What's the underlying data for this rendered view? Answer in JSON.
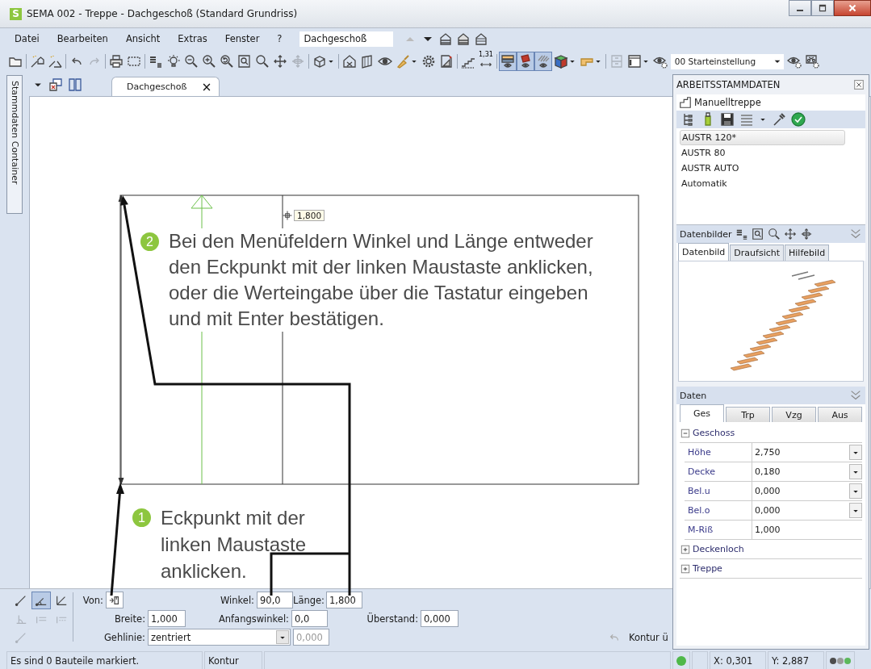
{
  "window": {
    "logo": "S",
    "title": "SEMA  002 - Treppe  - Dachgeschoß (Standard Grundriss)"
  },
  "menu": [
    "Datei",
    "Bearbeiten",
    "Ansicht",
    "Extras",
    "Fenster",
    "?"
  ],
  "level_selector": {
    "value": "Dachgeschoß"
  },
  "toolbar_groups": [
    [
      {
        "kind": "folder",
        "pressed": false,
        "disabled": false,
        "menu": false
      }
    ],
    [
      {
        "kind": "wand-house",
        "pressed": false,
        "disabled": false,
        "menu": false
      },
      {
        "kind": "wand-angle",
        "pressed": false,
        "disabled": false,
        "menu": false
      }
    ],
    [
      {
        "kind": "undo",
        "pressed": false,
        "disabled": false,
        "menu": false
      },
      {
        "kind": "redo",
        "pressed": false,
        "disabled": true,
        "menu": false
      }
    ],
    [
      {
        "kind": "printer",
        "pressed": false,
        "disabled": false,
        "menu": false
      },
      {
        "kind": "frame",
        "pressed": false,
        "disabled": false,
        "menu": false
      }
    ],
    [
      {
        "kind": "font-size",
        "pressed": false,
        "disabled": false,
        "menu": false
      },
      {
        "kind": "bulb",
        "pressed": false,
        "disabled": false,
        "menu": false
      },
      {
        "kind": "zoom-out",
        "pressed": false,
        "disabled": false,
        "menu": false
      },
      {
        "kind": "zoom-in",
        "pressed": false,
        "disabled": false,
        "menu": false
      },
      {
        "kind": "zoom-previous",
        "pressed": false,
        "disabled": false,
        "menu": false
      },
      {
        "kind": "zoom-page",
        "pressed": false,
        "disabled": false,
        "menu": false
      },
      {
        "kind": "search",
        "pressed": false,
        "disabled": false,
        "menu": false
      },
      {
        "kind": "move",
        "pressed": false,
        "disabled": false,
        "menu": false
      },
      {
        "kind": "move-3d",
        "pressed": false,
        "disabled": true,
        "menu": false
      }
    ],
    [
      {
        "kind": "view-cube",
        "pressed": false,
        "disabled": false,
        "menu": true
      }
    ],
    [
      {
        "kind": "house-cut",
        "pressed": false,
        "disabled": false,
        "menu": false
      },
      {
        "kind": "plane",
        "pressed": false,
        "disabled": false,
        "menu": false
      },
      {
        "kind": "eye",
        "pressed": false,
        "disabled": false,
        "menu": false
      },
      {
        "kind": "brush",
        "pressed": false,
        "disabled": false,
        "menu": true
      },
      {
        "kind": "gear",
        "pressed": false,
        "disabled": false,
        "menu": false
      },
      {
        "kind": "dxf",
        "pressed": false,
        "disabled": false,
        "menu": false
      }
    ],
    [
      {
        "kind": "stairs",
        "pressed": false,
        "disabled": false,
        "menu": false
      },
      {
        "kind": "dimension",
        "label": "1,31",
        "pressed": false,
        "disabled": false,
        "menu": false
      }
    ],
    [
      {
        "kind": "layer-bar",
        "pressed": true,
        "disabled": false,
        "menu": false
      },
      {
        "kind": "layer-red",
        "pressed": true,
        "disabled": false,
        "menu": false
      },
      {
        "kind": "layer-hatch",
        "pressed": true,
        "disabled": false,
        "menu": false
      },
      {
        "kind": "color-cube",
        "pressed": false,
        "disabled": false,
        "menu": true
      },
      {
        "kind": "beam",
        "pressed": false,
        "disabled": false,
        "menu": true
      }
    ],
    [
      {
        "kind": "cabinet",
        "pressed": false,
        "disabled": true,
        "menu": false
      },
      {
        "kind": "panel",
        "pressed": false,
        "disabled": false,
        "menu": true
      },
      {
        "kind": "eye-gear",
        "pressed": false,
        "disabled": false,
        "menu": false
      }
    ]
  ],
  "view_setting": {
    "value": "00 Starteinstellung"
  },
  "side_tab": "Stammdaten Container",
  "document_tabs": [
    {
      "label": "Dachgeschoß",
      "selected": true
    }
  ],
  "canvas": {
    "readout": "1,800",
    "callouts": [
      {
        "number": "2",
        "lines": [
          "Bei den Menüfeldern Winkel und Länge entweder",
          "den Eckpunkt mit der linken Maustaste anklicken,",
          "oder die Werteingabe über die Tastatur eingeben",
          "und mit Enter bestätigen."
        ]
      },
      {
        "number": "1",
        "lines": [
          "Eckpunkt mit der",
          "linken Maustaste",
          "anklicken."
        ]
      }
    ]
  },
  "input_panel": {
    "tools": [
      {
        "kind": "line-tool",
        "selected": false,
        "disabled": false
      },
      {
        "kind": "angle-tool",
        "selected": true,
        "disabled": false
      },
      {
        "kind": "corner-tool",
        "selected": false,
        "disabled": false
      },
      {
        "kind": "right-angle-tool",
        "selected": false,
        "disabled": true
      },
      {
        "kind": "parallel-tool",
        "selected": false,
        "disabled": true
      },
      {
        "kind": "parallel-dashed-tool",
        "selected": false,
        "disabled": true
      },
      {
        "kind": "line-tool",
        "selected": false,
        "disabled": true
      }
    ],
    "von": "Von:",
    "winkel": {
      "label": "Winkel:",
      "value": "90,0"
    },
    "laenge": {
      "label": "Länge:",
      "value": "1,800"
    },
    "breite": {
      "label": "Breite:",
      "value": "1,000"
    },
    "anfangswinkel": {
      "label": "Anfangswinkel:",
      "value": "0,0"
    },
    "ueberstand": {
      "label": "Überstand:",
      "value": "0,000"
    },
    "gehlinie": {
      "label": "Gehlinie:",
      "value": "zentriert"
    },
    "gehlinie_offset": {
      "value": "0,000",
      "disabled": true
    },
    "hint": "Kontur ü"
  },
  "status_bar": {
    "message": "Es sind 0 Bauteile markiert.",
    "mode": "Kontur",
    "x": "X: 0,301",
    "y": "Y: 2,887",
    "indicators": [
      {
        "color": "#4d4d4d"
      },
      {
        "color": "#9a9a9a"
      },
      {
        "color": "#5cb85c"
      }
    ]
  },
  "panel": {
    "title": "ARBEITSSTAMMDATEN",
    "object": "Manuelltreppe",
    "entries": [
      {
        "label": "AUSTR 120*",
        "selected": true
      },
      {
        "label": "AUSTR 80",
        "selected": false
      },
      {
        "label": "AUSTR AUTO",
        "selected": false
      },
      {
        "label": "Automatik",
        "selected": false
      }
    ],
    "images": {
      "title": "Datenbilder",
      "tabs": [
        {
          "label": "Datenbild",
          "selected": true
        },
        {
          "label": "Draufsicht",
          "selected": false
        },
        {
          "label": "Hilfebild",
          "selected": false
        }
      ]
    },
    "data": {
      "title": "Daten",
      "tabs": [
        {
          "label": "Ges",
          "selected": true
        },
        {
          "label": "Trp",
          "selected": false
        },
        {
          "label": "Vzg",
          "selected": false
        },
        {
          "label": "Aus",
          "selected": false
        }
      ],
      "groups": [
        {
          "label": "Geschoss",
          "expanded": true,
          "rows": [
            {
              "name": "Höhe",
              "value": "2,750",
              "dropdown": true
            },
            {
              "name": "Decke",
              "value": "0,180",
              "dropdown": true
            },
            {
              "name": "Bel.u",
              "value": "0,000",
              "dropdown": true
            },
            {
              "name": "Bel.o",
              "value": "0,000",
              "dropdown": true
            },
            {
              "name": "M-Riß",
              "value": "1,000",
              "dropdown": false
            }
          ]
        },
        {
          "label": "Deckenloch",
          "expanded": false
        },
        {
          "label": "Treppe",
          "expanded": false
        }
      ]
    }
  }
}
